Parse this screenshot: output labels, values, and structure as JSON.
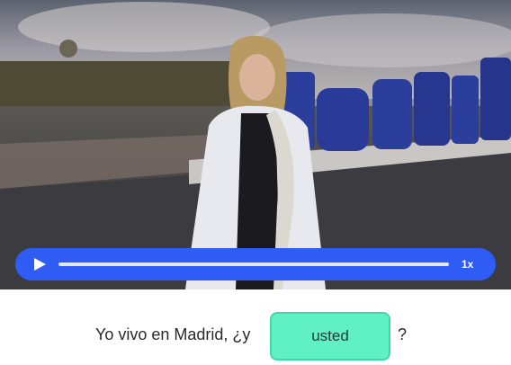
{
  "player": {
    "progress": 0.0,
    "speed_label": "1x",
    "accent_color": "#2f5cf5"
  },
  "exercise": {
    "text_before": "Yo vivo en Madrid, ¿y",
    "answer_chip": "usted",
    "text_after": "?",
    "chip_color": "#5ff0c4"
  }
}
